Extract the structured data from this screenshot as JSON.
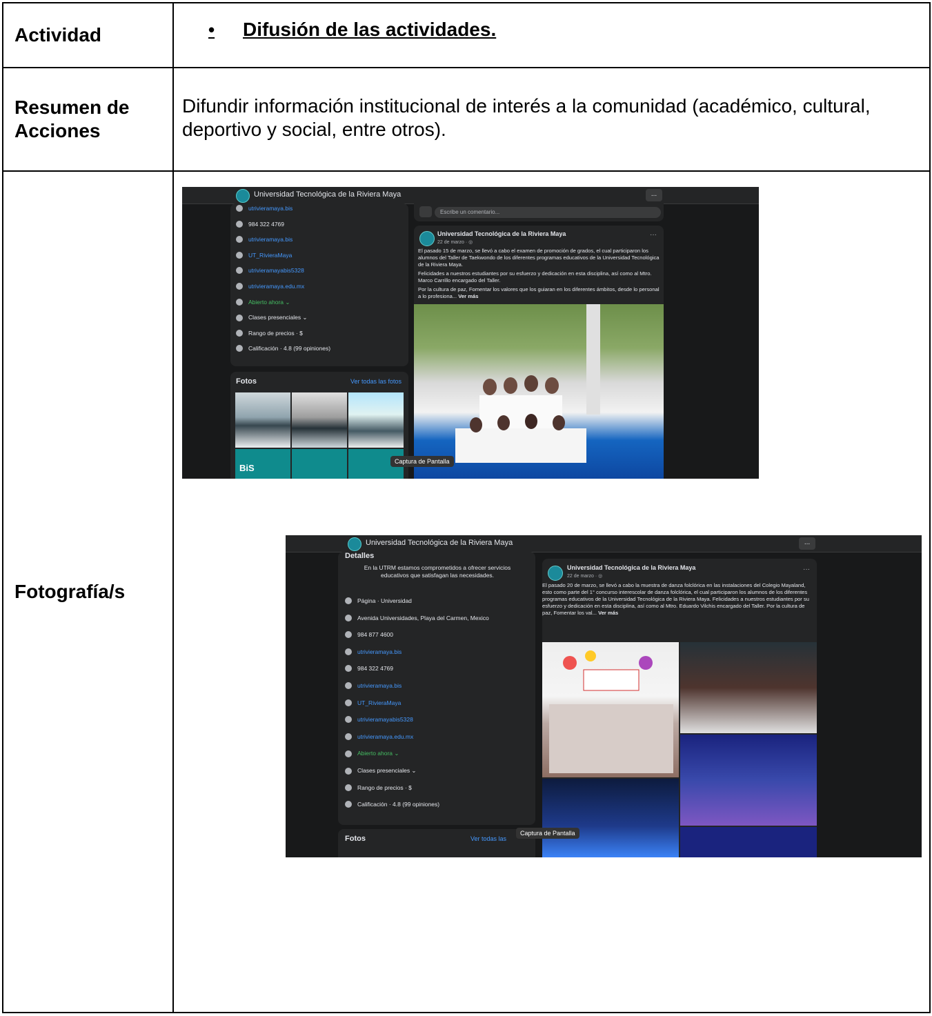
{
  "table": {
    "activity_label": "Actividad",
    "activity_bullet": "•",
    "activity_value": "Difusión de las actividades.",
    "summary_label_line1": "Resumen de",
    "summary_label_line2": "Acciones",
    "summary_text": "Difundir información institucional de interés a la comunidad (académico, cultural, deportivo y social, entre otros).",
    "photos_label": "Fotografía/s"
  },
  "screenshot1": {
    "page_title": "Universidad Tecnológica de la Riviera Maya",
    "more": "...",
    "info": [
      {
        "icon": "instagram-icon",
        "text": "utrivieramaya.bis",
        "style": "link"
      },
      {
        "icon": "whatsapp-icon",
        "text": "984 322 4769",
        "style": "plain"
      },
      {
        "icon": "tiktok-icon",
        "text": "utrivieramaya.bis",
        "style": "link"
      },
      {
        "icon": "x-icon",
        "text": "UT_RivieraMaya",
        "style": "link"
      },
      {
        "icon": "youtube-icon",
        "text": "utrivieramayabis5328",
        "style": "link"
      },
      {
        "icon": "globe-icon",
        "text": "utrivieramaya.edu.mx",
        "style": "link"
      },
      {
        "icon": "clock-icon",
        "text": "Abierto ahora ⌄",
        "style": "green"
      },
      {
        "icon": "school-icon",
        "text": "Clases presenciales ⌄",
        "style": "plain"
      },
      {
        "icon": "price-icon",
        "text": "Rango de precios · $",
        "style": "plain"
      },
      {
        "icon": "star-icon",
        "text": "Calificación · 4.8 (99 opiniones)",
        "style": "plain"
      }
    ],
    "photos_title": "Fotos",
    "photos_link": "Ver todas las fotos",
    "comment_placeholder": "Escribe un comentario...",
    "post_author": "Universidad Tecnológica de la Riviera Maya",
    "post_date": "22 de marzo · ◎",
    "post_p1": "El pasado 15 de marzo, se llevó a cabo el examen de promoción de grados, el cual participaron los alumnos del Taller de Taekwondo de los diferentes programas educativos de la Universidad Tecnológica de la Riviera Maya.",
    "post_p2": "Felicidades a nuestros estudiantes por su esfuerzo y dedicación en esta disciplina, así como al Mtro. Marco Carrillo encargado del Taller.",
    "post_p3": "Por la cultura de paz, Fomentar los valores que los guiaran en los diferentes ámbitos, desde lo personal a lo profesiona...",
    "see_more": "Ver más",
    "tooltip": "Captura de Pantalla",
    "tile_bis": "BiS"
  },
  "screenshot2": {
    "page_title": "Universidad Tecnológica de la Riviera Maya",
    "more": "...",
    "details_heading": "Detalles",
    "details_intro": "En la UTRM estamos comprometidos a ofrecer servicios educativos que satisfagan las necesidades.",
    "info": [
      {
        "icon": "info-icon",
        "text": "Página · Universidad",
        "style": "plain",
        "bold": "Página"
      },
      {
        "icon": "location-icon",
        "text": "Avenida Universidades, Playa del Carmen, Mexico",
        "style": "plain"
      },
      {
        "icon": "phone-icon",
        "text": "984 877 4600",
        "style": "plain"
      },
      {
        "icon": "instagram-icon",
        "text": "utrivieramaya.bis",
        "style": "link"
      },
      {
        "icon": "whatsapp-icon",
        "text": "984 322 4769",
        "style": "plain"
      },
      {
        "icon": "tiktok-icon",
        "text": "utrivieramaya.bis",
        "style": "link"
      },
      {
        "icon": "x-icon",
        "text": "UT_RivieraMaya",
        "style": "link"
      },
      {
        "icon": "youtube-icon",
        "text": "utrivieramayabis5328",
        "style": "link"
      },
      {
        "icon": "globe-icon",
        "text": "utrivieramaya.edu.mx",
        "style": "link"
      },
      {
        "icon": "clock-icon",
        "text": "Abierto ahora ⌄",
        "style": "green"
      },
      {
        "icon": "school-icon",
        "text": "Clases presenciales ⌄",
        "style": "plain"
      },
      {
        "icon": "price-icon",
        "text": "Rango de precios · $",
        "style": "plain"
      },
      {
        "icon": "star-icon",
        "text": "Calificación · 4.8 (99 opiniones)",
        "style": "plain"
      }
    ],
    "photos_title": "Fotos",
    "photos_link": "Ver todas las",
    "post_author": "Universidad Tecnológica de la Riviera Maya",
    "post_date": "22 de marzo · ◎",
    "post_text": "El pasado 20 de marzo, se llevó a cabo la muestra de danza folclórica en las instalaciones del Colegio Mayaland, esto como parte del 1° concurso interescolar de danza folclórica, el cual participaron los alumnos de los diferentes programas educativos de la Universidad Tecnológica de la Riviera Maya. Felicidades a nuestros estudiantes por su esfuerzo y dedicación en esta disciplina, así como al Mtro. Eduardo Vilchis encargado del Taller. Por la cultura de paz, Fomentar los val...",
    "see_more": "Ver más",
    "tooltip": "Captura de Pantalla"
  }
}
